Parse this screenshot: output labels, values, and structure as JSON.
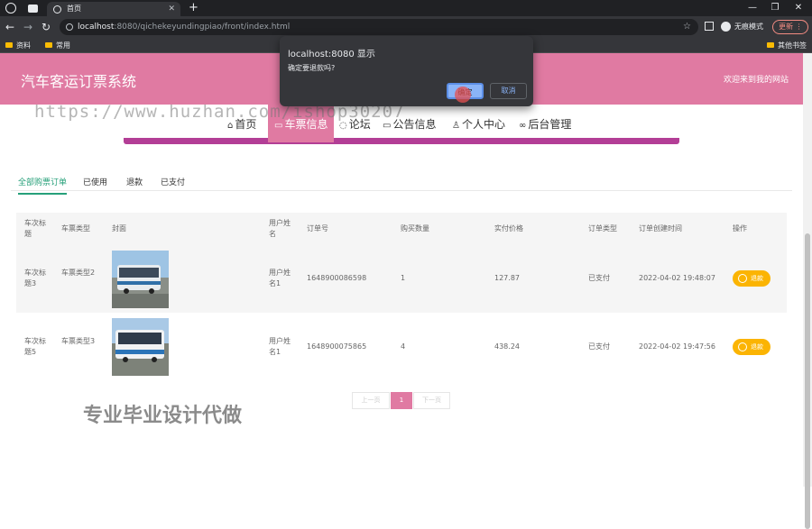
{
  "browser": {
    "tab_title": "首页",
    "url_host": "localhost",
    "url_path": ":8080/qichekeyundingpiao/front/index.html",
    "incognito_label": "无痕模式",
    "update_label": "更新",
    "bookmarks": [
      "资料",
      "常用"
    ],
    "other_bookmarks": "其他书签"
  },
  "header": {
    "site_title": "汽车客运订票系统",
    "welcome": "欢迎来到我的网站"
  },
  "nav": {
    "items": [
      {
        "label": "首页",
        "icon": "home-icon"
      },
      {
        "label": "车票信息",
        "icon": "ticket-icon"
      },
      {
        "label": "论坛",
        "icon": "forum-icon"
      },
      {
        "label": "公告信息",
        "icon": "announcement-icon"
      },
      {
        "label": "个人中心",
        "icon": "user-icon"
      },
      {
        "label": "后台管理",
        "icon": "link-icon"
      }
    ]
  },
  "subtabs": [
    "全部购票订单",
    "已使用",
    "退款",
    "已支付"
  ],
  "table": {
    "headers": [
      "车次标题",
      "车票类型",
      "封面",
      "用户姓名",
      "订单号",
      "购买数量",
      "实付价格",
      "订单类型",
      "订单创建时间",
      "操作"
    ],
    "rows": [
      {
        "title": "车次标题3",
        "type": "车票类型2",
        "user": "用户姓名1",
        "order_no": "1648900086598",
        "qty": "1",
        "price": "127.87",
        "order_type": "已支付",
        "created": "2022-04-02 19:48:07",
        "action": "退款"
      },
      {
        "title": "车次标题5",
        "type": "车票类型3",
        "user": "用户姓名1",
        "order_no": "1648900075865",
        "qty": "4",
        "price": "438.24",
        "order_type": "已支付",
        "created": "2022-04-02 19:47:56",
        "action": "退款"
      }
    ]
  },
  "pagination": {
    "prev": "上一页",
    "current": "1",
    "next": "下一页"
  },
  "dialog": {
    "title": "localhost:8080 显示",
    "message": "确定要退款吗?",
    "ok": "确定",
    "cancel": "取消"
  },
  "watermark": {
    "url": "https://www.huzhan.com/ishop30207",
    "text": "专业毕业设计代做"
  },
  "colors": {
    "header_pink": "#e07aa2",
    "nav_border_purple": "#b33e96",
    "refund_yellow": "#fbb403",
    "tab_active_green": "#27a07a"
  }
}
